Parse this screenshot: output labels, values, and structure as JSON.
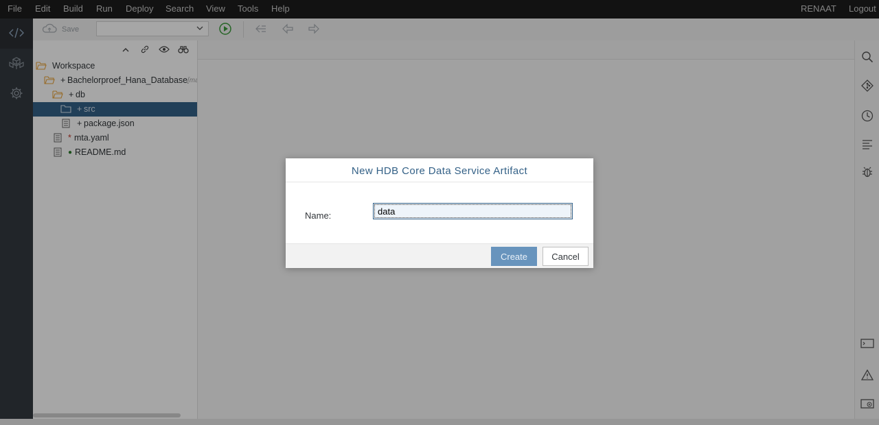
{
  "menu": {
    "items": [
      "File",
      "Edit",
      "Build",
      "Run",
      "Deploy",
      "Search",
      "View",
      "Tools",
      "Help"
    ],
    "user": "RENAAT",
    "logout": "Logout"
  },
  "toolbar": {
    "save_label": "Save",
    "run_config_value": ""
  },
  "explorer": {
    "tree": [
      {
        "label": "Workspace",
        "prefix": "",
        "icon": "folder-open-icon",
        "selected": false
      },
      {
        "label": "Bachelorproef_Hana_Database",
        "prefix": "+",
        "icon": "folder-open-icon",
        "hint": "[ma",
        "selected": false
      },
      {
        "label": "db",
        "prefix": "+",
        "icon": "folder-open-icon",
        "selected": false
      },
      {
        "label": "src",
        "prefix": "+",
        "icon": "folder-icon",
        "selected": true
      },
      {
        "label": "package.json",
        "prefix": "+",
        "icon": "file-icon",
        "selected": false
      },
      {
        "label": "mta.yaml",
        "prefix": "*",
        "icon": "file-icon",
        "selected": false
      },
      {
        "label": "README.md",
        "prefix": "●",
        "icon": "file-icon",
        "selected": false
      }
    ]
  },
  "dialog": {
    "title": "New HDB Core Data Service Artifact",
    "name_label": "Name:",
    "name_value": "data",
    "create_label": "Create",
    "cancel_label": "Cancel"
  },
  "colors": {
    "menubar_bg": "#1c1c1c",
    "rail_bg": "#34393f",
    "selection_bg": "#346187",
    "title_color": "#346187",
    "create_btn_bg": "#6894bd",
    "folder_color": "#e8a33c",
    "status_green": "#2b7c2b",
    "status_red": "#c0392b"
  }
}
